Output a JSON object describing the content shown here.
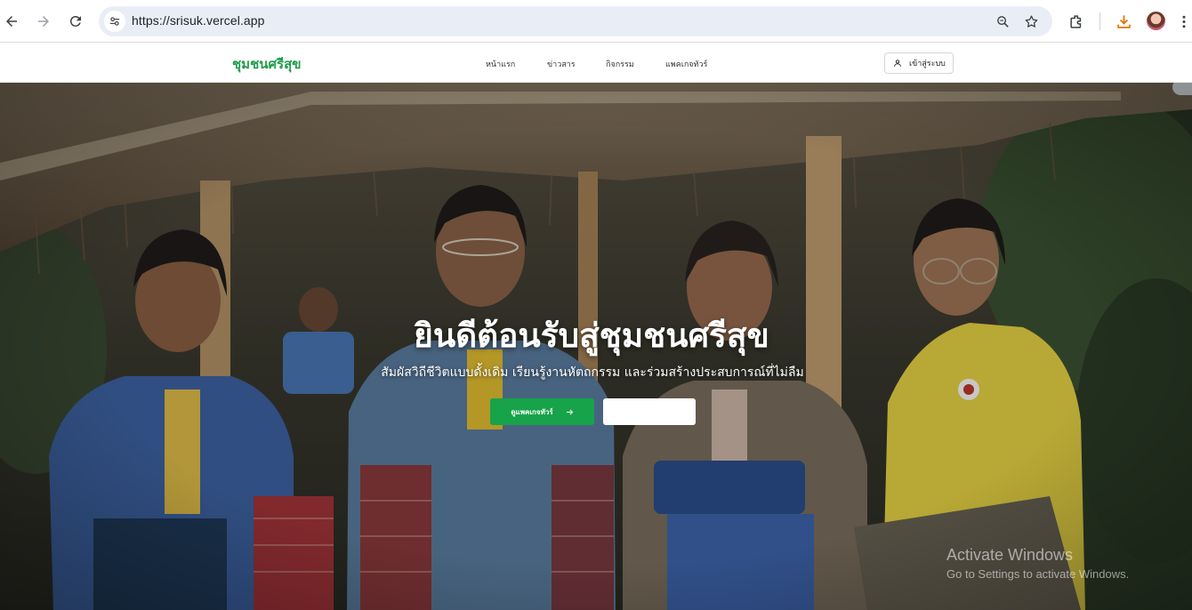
{
  "browser": {
    "url": "https://srisuk.vercel.app"
  },
  "site": {
    "brand": "ชุมชนศรีสุข",
    "nav": [
      {
        "label": "หน้าแรก"
      },
      {
        "label": "ข่าวสาร"
      },
      {
        "label": "กิจกรรม"
      },
      {
        "label": "แพคเกจทัวร์"
      }
    ],
    "login_label": "เข้าสู่ระบบ"
  },
  "hero": {
    "title": "ยินดีต้อนรับสู่ชุมชนศรีสุข",
    "subtitle": "สัมผัสวิถีชีวิตแบบดั้งเดิม เรียนรู้งานหัตถกรรม และร่วมสร้างประสบการณ์ที่ไม่ลืม",
    "primary_cta": "ดูแพคเกจทัวร์",
    "primary_cta_icon": "arrow-right-icon",
    "secondary_cta": ""
  },
  "watermark": {
    "title": "Activate Windows",
    "subtitle": "Go to Settings to activate Windows."
  },
  "colors": {
    "brand_green": "#1f9d4a",
    "cta_green": "#16a34a",
    "omnibox_bg": "#e9eef6",
    "download_orange": "#e37400"
  }
}
